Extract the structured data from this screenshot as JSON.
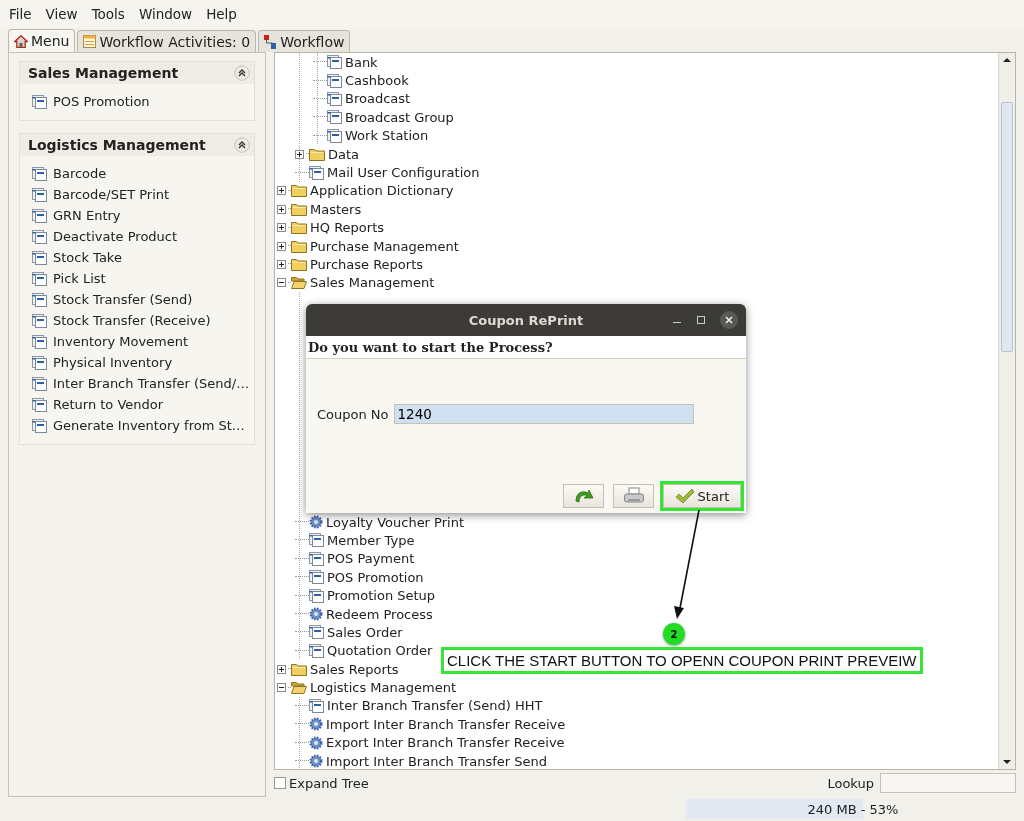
{
  "menu_bar": [
    "File",
    "View",
    "Tools",
    "Window",
    "Help"
  ],
  "tabs": [
    {
      "label": "Menu",
      "kind": "home",
      "selected": true
    },
    {
      "label": "Workflow Activities: 0",
      "kind": "activities",
      "selected": false
    },
    {
      "label": "Workflow",
      "kind": "workflow",
      "selected": false
    }
  ],
  "sidebar": {
    "panels": [
      {
        "title": "Sales Management",
        "expanded": true,
        "items": [
          "POS Promotion"
        ]
      },
      {
        "title": "Logistics Management",
        "expanded": true,
        "items": [
          "Barcode",
          "Barcode/SET Print",
          "GRN Entry",
          "Deactivate Product",
          "Stock Take",
          "Pick List",
          "Stock Transfer (Send)",
          "Stock Transfer (Receive)",
          "Inventory Movement",
          "Physical Inventory",
          "Inter Branch Transfer (Send/…",
          "Return to Vendor",
          "Generate Inventory from St…"
        ]
      }
    ]
  },
  "tree": {
    "items": [
      {
        "children": [
          {
            "children": [
              {
                "kind": "window",
                "label": "Bank"
              },
              {
                "kind": "window",
                "label": "Cashbook"
              },
              {
                "kind": "window",
                "label": "Broadcast"
              },
              {
                "kind": "window",
                "label": "Broadcast Group"
              },
              {
                "kind": "window",
                "label": "Work Station"
              }
            ]
          },
          {
            "kind": "folder",
            "label": "Data",
            "expanded": false
          },
          {
            "kind": "window",
            "label": "Mail User Configuration"
          }
        ]
      },
      {
        "kind": "folder",
        "label": "Application Dictionary",
        "expanded": false
      },
      {
        "kind": "folder",
        "label": "Masters",
        "expanded": false
      },
      {
        "kind": "folder",
        "label": "HQ Reports",
        "expanded": false
      },
      {
        "kind": "folder",
        "label": "Purchase Management",
        "expanded": false
      },
      {
        "kind": "folder",
        "label": "Purchase Reports",
        "expanded": false
      },
      {
        "kind": "folder",
        "label": "Sales Management",
        "expanded": true,
        "children": [
          {
            "kind": "covered"
          },
          {
            "kind": "process",
            "label": "Loyalty Voucher Print"
          },
          {
            "kind": "window",
            "label": "Member Type"
          },
          {
            "kind": "window",
            "label": "POS Payment"
          },
          {
            "kind": "window",
            "label": "POS Promotion"
          },
          {
            "kind": "window",
            "label": "Promotion Setup"
          },
          {
            "kind": "process",
            "label": "Redeem Process"
          },
          {
            "kind": "window",
            "label": "Sales Order"
          },
          {
            "kind": "window",
            "label": "Quotation Order"
          }
        ]
      },
      {
        "kind": "folder",
        "label": "Sales Reports",
        "expanded": false
      },
      {
        "kind": "folder",
        "label": "Logistics Management",
        "expanded": true,
        "children": [
          {
            "kind": "window",
            "label": "Inter Branch Transfer (Send) HHT"
          },
          {
            "kind": "process",
            "label": "Import Inter Branch Transfer Receive"
          },
          {
            "kind": "process",
            "label": "Export Inter Branch Transfer Receive"
          },
          {
            "kind": "process",
            "label": "Import Inter Branch Transfer Send"
          }
        ]
      }
    ]
  },
  "dialog": {
    "title": "Coupon RePrint",
    "prompt": "Do you want to start the Process?",
    "fields": [
      {
        "label": "Coupon No",
        "value": "1240"
      }
    ],
    "buttons": [
      {
        "kind": "redo",
        "highlighted": false
      },
      {
        "kind": "print",
        "highlighted": false
      },
      {
        "kind": "start",
        "label": "Start",
        "highlighted": true
      }
    ]
  },
  "annotation": {
    "step": "2",
    "text": "CLICK THE START BUTTON TO OPENN COUPON PRINT PREVEIW"
  },
  "bottom_bar": {
    "expand_tree": {
      "label": "Expand Tree",
      "checked": false
    },
    "lookup": {
      "label": "Lookup"
    }
  },
  "status_bar": {
    "memory": {
      "text": "240 MB - 53%",
      "level": 0.53
    }
  }
}
